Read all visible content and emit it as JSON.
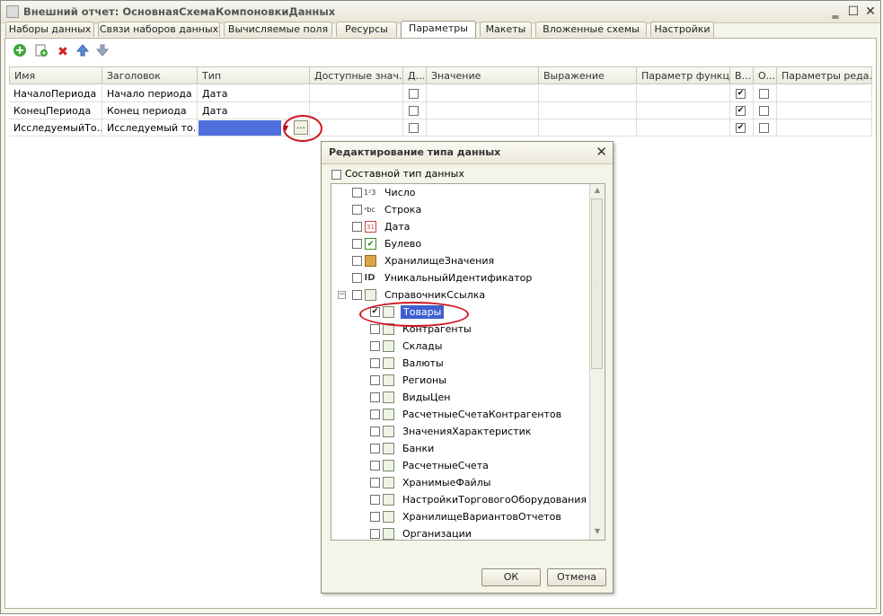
{
  "window": {
    "title": "Внешний отчет: ОсновнаяСхемаКомпоновкиДанных"
  },
  "tabs": [
    {
      "label": "Наборы данных"
    },
    {
      "label": "Связи наборов данных"
    },
    {
      "label": "Вычисляемые поля"
    },
    {
      "label": "Ресурсы"
    },
    {
      "label": "Параметры"
    },
    {
      "label": "Макеты"
    },
    {
      "label": "Вложенные схемы"
    },
    {
      "label": "Настройки"
    }
  ],
  "active_tab": "Параметры",
  "toolbar": [
    {
      "icon": "add-icon"
    },
    {
      "icon": "copy-icon"
    },
    {
      "icon": "delete-icon"
    },
    {
      "icon": "move-up-icon"
    },
    {
      "icon": "move-down-icon"
    }
  ],
  "grid": {
    "columns": [
      {
        "label": "Имя"
      },
      {
        "label": "Заголовок"
      },
      {
        "label": "Тип"
      },
      {
        "label": "Доступные знач..."
      },
      {
        "label": "Д..."
      },
      {
        "label": "Значение"
      },
      {
        "label": "Выражение"
      },
      {
        "label": "Параметр функц..."
      },
      {
        "label": "В..."
      },
      {
        "label": "О..."
      },
      {
        "label": "Параметры реда..."
      }
    ],
    "rows": [
      {
        "name": "НачалоПериода",
        "caption": "Начало периода",
        "type": "Дата",
        "d": false,
        "v": true,
        "o": false
      },
      {
        "name": "КонецПериода",
        "caption": "Конец периода",
        "type": "Дата",
        "d": false,
        "v": true,
        "o": false
      },
      {
        "name": "ИсследуемыйТо...",
        "caption": "Исследуемый то...",
        "type": "",
        "d": false,
        "v": true,
        "o": false
      }
    ],
    "ellipsis_label": "..."
  },
  "dialog": {
    "title": "Редактирование типа данных",
    "composite_label": "Составной тип данных",
    "composite_checked": false,
    "types": [
      {
        "label": "Число",
        "icon": "number-icon",
        "checked": false
      },
      {
        "label": "Строка",
        "icon": "string-icon",
        "checked": false
      },
      {
        "label": "Дата",
        "icon": "calendar-icon",
        "checked": false
      },
      {
        "label": "Булево",
        "icon": "boolean-icon",
        "checked": false
      },
      {
        "label": "ХранилищеЗначения",
        "icon": "storage-icon",
        "checked": false
      },
      {
        "label": "УникальныйИдентификатор",
        "icon": "id-icon",
        "checked": false
      },
      {
        "label": "СправочникСсылка",
        "icon": "catalog-icon",
        "checked": false
      }
    ],
    "catalogs": [
      {
        "label": "Товары",
        "checked": true
      },
      {
        "label": "Контрагенты",
        "checked": false
      },
      {
        "label": "Склады",
        "checked": false
      },
      {
        "label": "Валюты",
        "checked": false
      },
      {
        "label": "Регионы",
        "checked": false
      },
      {
        "label": "ВидыЦен",
        "checked": false
      },
      {
        "label": "РасчетныеСчетаКонтрагентов",
        "checked": false
      },
      {
        "label": "ЗначенияХарактеристик",
        "checked": false
      },
      {
        "label": "Банки",
        "checked": false
      },
      {
        "label": "РасчетныеСчета",
        "checked": false
      },
      {
        "label": "ХранимыеФайлы",
        "checked": false
      },
      {
        "label": "НастройкиТорговогоОборудования",
        "checked": false
      },
      {
        "label": "ХранилищеВариантовОтчетов",
        "checked": false
      },
      {
        "label": "Организации",
        "checked": false
      }
    ],
    "ok_label": "ОК",
    "cancel_label": "Отмена"
  },
  "colors": {
    "selection": "#3d5fd0",
    "highlight_circle": "#d0141f",
    "window_bg": "#f5f4e8"
  }
}
